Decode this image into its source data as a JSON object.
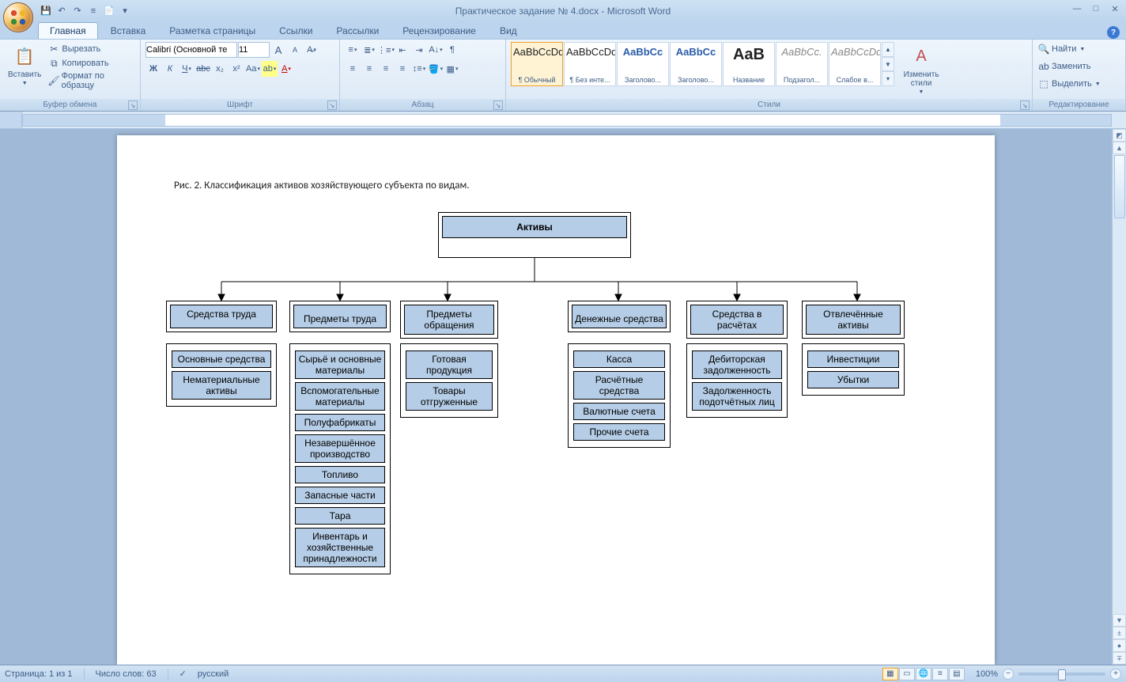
{
  "app": {
    "title": "Практическое задание № 4.docx - Microsoft Word"
  },
  "tabs": {
    "home": "Главная",
    "insert": "Вставка",
    "layout": "Разметка страницы",
    "refs": "Ссылки",
    "mail": "Рассылки",
    "review": "Рецензирование",
    "view": "Вид"
  },
  "clipboard": {
    "paste": "Вставить",
    "cut": "Вырезать",
    "copy": "Копировать",
    "format": "Формат по образцу",
    "label": "Буфер обмена"
  },
  "font": {
    "name": "Calibri (Основной те",
    "size": "11",
    "label": "Шрифт"
  },
  "paragraph": {
    "label": "Абзац"
  },
  "styles": {
    "label": "Стили",
    "change": "Изменить стили",
    "items": [
      {
        "preview": "AaBbCcDd",
        "name": "¶ Обычный"
      },
      {
        "preview": "AaBbCcDd",
        "name": "¶ Без инте..."
      },
      {
        "preview": "AaBbCc",
        "name": "Заголово..."
      },
      {
        "preview": "AaBbCc",
        "name": "Заголово..."
      },
      {
        "preview": "AaB",
        "name": "Название"
      },
      {
        "preview": "AaBbCc.",
        "name": "Подзагол..."
      },
      {
        "preview": "AaBbCcDd",
        "name": "Слабое в..."
      }
    ]
  },
  "editing": {
    "label": "Редактирование",
    "find": "Найти",
    "replace": "Заменить",
    "select": "Выделить"
  },
  "document": {
    "caption": "Рис. 2. Классификация активов хозяйствующего субъекта по видам.",
    "root": "Активы",
    "cats": [
      {
        "title": "Средства труда",
        "items": [
          "Основные средства",
          "Нематериальные активы"
        ]
      },
      {
        "title": "Предметы труда",
        "items": [
          "Сырьё и основные материалы",
          "Вспомогательные материалы",
          "Полуфабрикаты",
          "Незавершённое производство",
          "Топливо",
          "Запасные части",
          "Тара",
          "Инвентарь и хозяйственные принадлежности"
        ]
      },
      {
        "title": "Предметы обращения",
        "items": [
          "Готовая продукция",
          "Товары отгруженные"
        ]
      },
      {
        "title": "Денежные средства",
        "items": [
          "Касса",
          "Расчётные средства",
          "Валютные счета",
          "Прочие счета"
        ]
      },
      {
        "title": "Средства в расчётах",
        "items": [
          "Дебиторская задолженность",
          "Задолженность подотчётных лиц"
        ]
      },
      {
        "title": "Отвлечённые активы",
        "items": [
          "Инвестиции",
          "Убытки"
        ]
      }
    ]
  },
  "status": {
    "page": "Страница: 1 из 1",
    "words": "Число слов: 63",
    "lang": "русский",
    "zoom": "100%"
  }
}
